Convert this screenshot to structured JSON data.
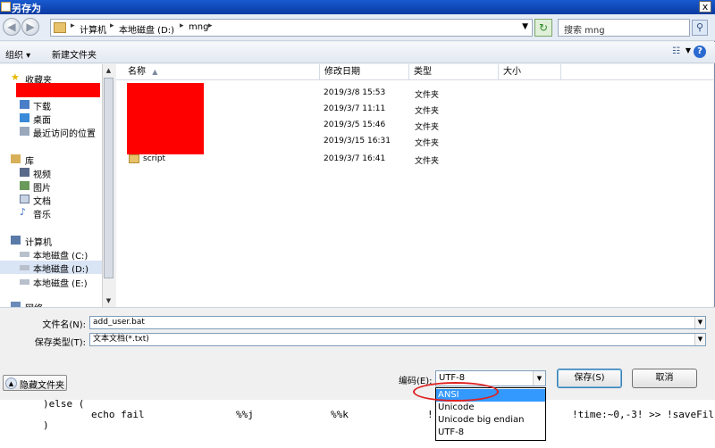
{
  "window": {
    "title": "另存为",
    "close_glyph": "x"
  },
  "address_bar": {
    "crumbs": [
      "计算机",
      "本地磁盘 (D:)",
      "mng"
    ],
    "search_placeholder": "搜索 mng"
  },
  "toolbar": {
    "organize_label": "组织 ▾",
    "new_folder_label": "新建文件夹"
  },
  "nav_pane": {
    "favorites": "收藏夹",
    "fav_items": [
      "下载",
      "桌面",
      "最近访问的位置"
    ],
    "libraries": "库",
    "lib_items": [
      "视频",
      "图片",
      "文档",
      "音乐"
    ],
    "computer": "计算机",
    "drives": [
      "本地磁盘 (C:)",
      "本地磁盘 (D:)",
      "本地磁盘 (E:)"
    ],
    "network": "网络"
  },
  "file_list": {
    "columns": [
      "名称",
      "修改日期",
      "类型",
      "大小"
    ],
    "rows": [
      {
        "name": "",
        "date": "2019/3/8 15:53",
        "type": "文件夹"
      },
      {
        "name": "",
        "date": "2019/3/7 11:11",
        "type": "文件夹"
      },
      {
        "name": "",
        "date": "2019/3/5 15:46",
        "type": "文件夹"
      },
      {
        "name": "",
        "date": "2019/3/15 16:31",
        "type": "文件夹"
      },
      {
        "name": "script",
        "date": "2019/3/7 16:41",
        "type": "文件夹"
      }
    ]
  },
  "form": {
    "filename_label": "文件名(N):",
    "filename_value": "add_user.bat",
    "filetype_label": "保存类型(T):",
    "filetype_value": "文本文档(*.txt)",
    "encoding_label": "编码(E):",
    "encoding_value": "UTF-8",
    "encoding_options": [
      "ANSI",
      "Unicode",
      "Unicode big endian",
      "UTF-8"
    ],
    "hide_folders_label": "隐藏文件夹",
    "save_label": "保存(S)",
    "cancel_label": "取消"
  },
  "background_editor": {
    "line1": ")else (",
    "line2_a": "echo fail",
    "line2_b": "%%j",
    "line2_c": "%%k",
    "line2_d": "!",
    "line2_e": "!time:~0,-3! >> !saveFil",
    "line3": ")"
  },
  "colors": {
    "title_bar": "#0a3aa0",
    "redaction": "#ff0000",
    "selection": "#3399ff",
    "highlight_ring": "#e02020"
  }
}
